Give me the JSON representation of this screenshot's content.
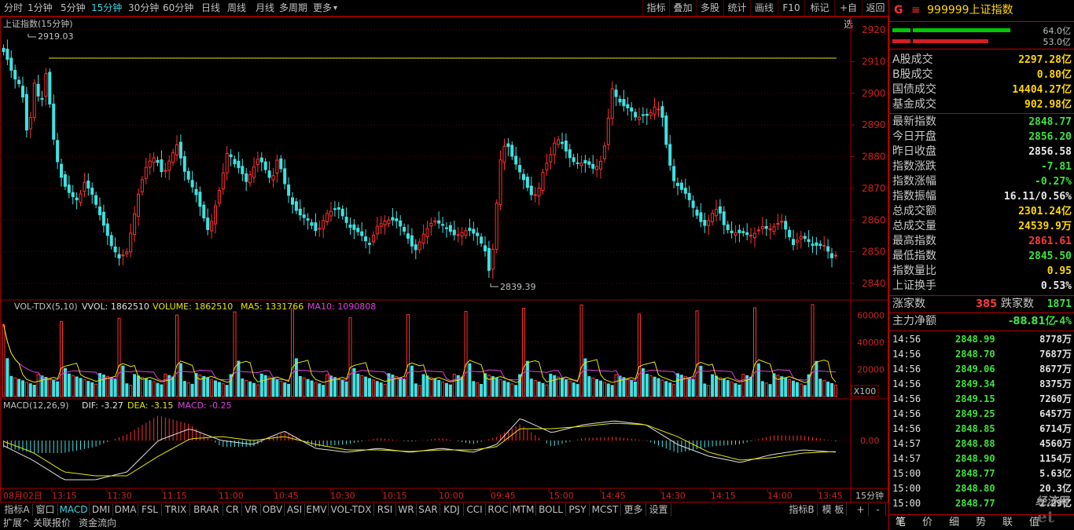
{
  "toolbar": {
    "periods": [
      "分时",
      "1分钟",
      "5分钟",
      "15分钟",
      "30分钟",
      "60分钟",
      "日线",
      "周线",
      "月线",
      "多周期",
      "更多"
    ],
    "active_period": "15分钟",
    "right_buttons": [
      "指标",
      "叠加",
      "多股",
      "统计",
      "画线",
      "F10",
      "标记",
      "+自选",
      "返回"
    ]
  },
  "chart": {
    "main_title": "上证指数(15分钟)",
    "price_axis": [
      "2920",
      "2910",
      "2900",
      "2890",
      "2880",
      "2870",
      "2860",
      "2850",
      "2840"
    ],
    "high_label": "2919.03",
    "low_label": "2839.39",
    "vol_title": "VOL-TDX(5,10)",
    "vol_vol": "VVOL: 1862510",
    "vol_volume": "VOLUME: 1862510",
    "vol_ma5": "MA5: 1331766",
    "vol_ma10": "MA10: 1090808",
    "vol_axis": [
      "60000",
      "40000",
      "20000"
    ],
    "vol_unit": "X100",
    "macd_title": "MACD(12,26,9)",
    "macd_dif": "DIF: -3.27",
    "macd_dea": "DEA: -3.15",
    "macd_val": "MACD: -0.25",
    "macd_axis": "0.00",
    "time_axis": [
      "08月02日",
      "13:15",
      "11:30",
      "11:15",
      "11:00",
      "10:45",
      "10:30",
      "10:15",
      "10:00",
      "09:45",
      "15:00",
      "14:45",
      "14:30",
      "14:15",
      "14:00",
      "13:45"
    ],
    "period_label": "15分钟"
  },
  "indicator_tabs": [
    "指标A",
    "窗口",
    "MACD",
    "DMI",
    "DMA",
    "FSL",
    "TRIX",
    "BRAR",
    "CR",
    "VR",
    "OBV",
    "ASI",
    "EMV",
    "VOL-TDX",
    "RSI",
    "WR",
    "SAR",
    "KDJ",
    "CCI",
    "ROC",
    "MTM",
    "BOLL",
    "PSY",
    "MCST",
    "更多",
    "设置"
  ],
  "active_indicator": "MACD",
  "indicator_right": [
    "指标B",
    "模 板",
    "+",
    "-"
  ],
  "bottom_tabs": [
    "扩展^",
    "关联报价",
    "资金流向"
  ],
  "quote": {
    "flag": "G",
    "menu": "≡",
    "code": "999999",
    "name": "上证指数",
    "bar1_pct": "64.0亿",
    "bar2_pct": "53.0亿",
    "turnover": [
      {
        "k": "A股成交",
        "v": "2297.28亿",
        "c": "#ffd700"
      },
      {
        "k": "B股成交",
        "v": "0.80亿",
        "c": "#ffd700"
      },
      {
        "k": "国债成交",
        "v": "14404.27亿",
        "c": "#ffd700"
      },
      {
        "k": "基金成交",
        "v": "902.98亿",
        "c": "#ffd700"
      }
    ],
    "stats": [
      {
        "k": "最新指数",
        "v": "2848.77",
        "c": "#3fe23f"
      },
      {
        "k": "今日开盘",
        "v": "2856.20",
        "c": "#3fe23f"
      },
      {
        "k": "昨日收盘",
        "v": "2856.58",
        "c": "#e8e8e8"
      },
      {
        "k": "指数涨跌",
        "v": "-7.81",
        "c": "#3fe23f"
      },
      {
        "k": "指数涨幅",
        "v": "-0.27%",
        "c": "#3fe23f"
      },
      {
        "k": "指数振幅",
        "v": "16.11/0.56%",
        "c": "#e8e8e8"
      },
      {
        "k": "总成交额",
        "v": "2301.24亿",
        "c": "#ffd700"
      },
      {
        "k": "总成交量",
        "v": "24539.9万",
        "c": "#ffd700"
      },
      {
        "k": "最高指数",
        "v": "2861.61",
        "c": "#ff3838"
      },
      {
        "k": "最低指数",
        "v": "2845.50",
        "c": "#3fe23f"
      },
      {
        "k": "指数量比",
        "v": "0.95",
        "c": "#ffd700"
      },
      {
        "k": "上证换手",
        "v": "0.53%",
        "c": "#e8e8e8"
      }
    ],
    "up_label": "涨家数",
    "up_count": "385",
    "down_label": "跌家数",
    "down_count": "1871",
    "main_net_label": "主力净额",
    "main_net": "-88.81亿",
    "main_net_pct": "-4%",
    "ticks": [
      {
        "t": "14:56",
        "p": "2848.99",
        "q": "8778万"
      },
      {
        "t": "14:56",
        "p": "2848.70",
        "q": "7687万"
      },
      {
        "t": "14:56",
        "p": "2849.06",
        "q": "8677万"
      },
      {
        "t": "14:56",
        "p": "2849.34",
        "q": "8375万"
      },
      {
        "t": "14:56",
        "p": "2849.15",
        "q": "7260万"
      },
      {
        "t": "14:56",
        "p": "2849.25",
        "q": "6457万"
      },
      {
        "t": "14:56",
        "p": "2848.85",
        "q": "6714万"
      },
      {
        "t": "14:57",
        "p": "2848.88",
        "q": "4560万"
      },
      {
        "t": "14:57",
        "p": "2848.90",
        "q": "1154万"
      },
      {
        "t": "15:00",
        "p": "2848.77",
        "q": "5.63亿"
      },
      {
        "t": "15:00",
        "p": "2848.80",
        "q": "20.3亿"
      },
      {
        "t": "15:00",
        "p": "2848.77",
        "q": "2.29亿"
      }
    ],
    "bottom_tabs": [
      "笔",
      "价",
      "细",
      "势",
      "联",
      "值"
    ],
    "watermark": "经济网"
  }
}
